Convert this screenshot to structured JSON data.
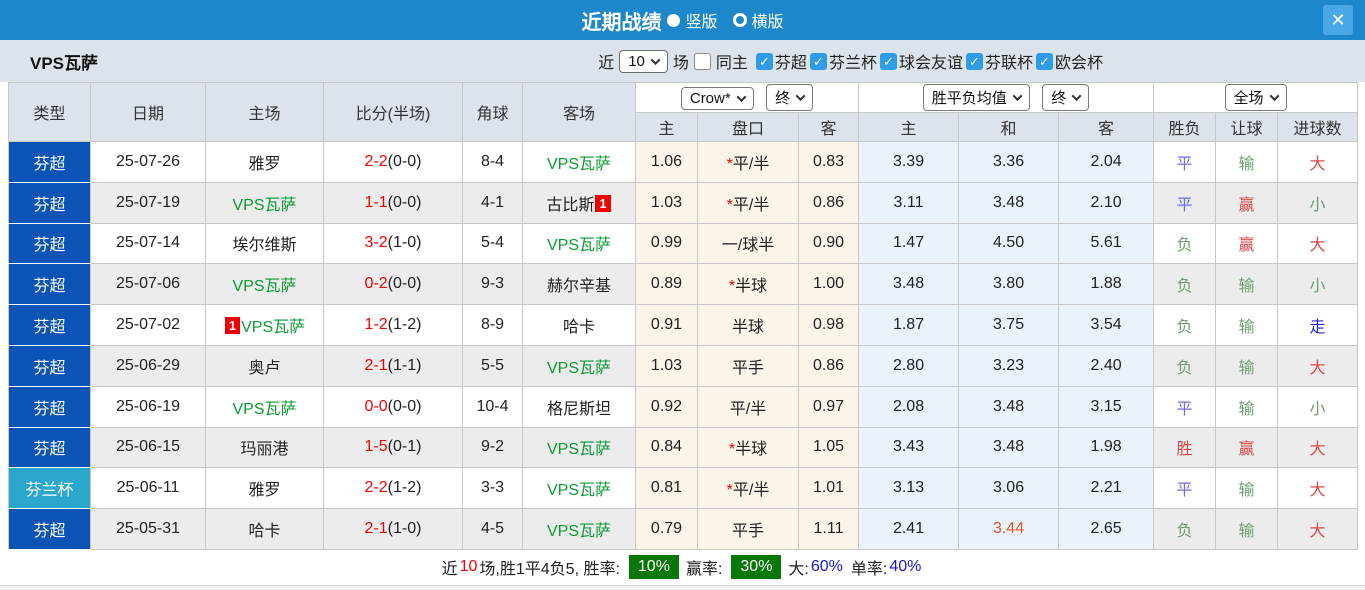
{
  "titlebar": {
    "title": "近期战绩",
    "radio_vertical": "竖版",
    "radio_horizontal": "横版",
    "close": "✕"
  },
  "filterbar": {
    "team": "VPS瓦萨",
    "recent_label": "近",
    "recent_value": "10",
    "matches_label": "场",
    "same_home_label": "同主",
    "leagues": [
      "芬超",
      "芬兰杯",
      "球会友谊",
      "芬联杯",
      "欧会杯"
    ]
  },
  "table": {
    "headers_left": [
      "类型",
      "日期",
      "主场",
      "比分(半场)",
      "角球",
      "客场"
    ],
    "dropdowns": {
      "odds_source": "Crow*",
      "odds_time": "终",
      "wdl_source": "胜平负均值",
      "wdl_time": "终",
      "scope": "全场"
    },
    "subheaders": [
      "主",
      "盘口",
      "客",
      "主",
      "和",
      "客",
      "胜负",
      "让球",
      "进球数"
    ],
    "rows": [
      {
        "type": "芬超",
        "cup": false,
        "date": "25-07-26",
        "home": "雅罗",
        "home_green": false,
        "home_badge": "",
        "home_badge_pos": "",
        "score": "2-2",
        "half": "(0-0)",
        "corner": "8-4",
        "away": "VPS瓦萨",
        "away_green": true,
        "away_badge": "",
        "away_badge_pos": "",
        "crow": [
          "1.06",
          "平/半",
          "0.83"
        ],
        "star": true,
        "europe": [
          "3.39",
          "3.36",
          "2.04"
        ],
        "draw_red": false,
        "results": [
          [
            "平",
            "blue"
          ],
          [
            "输",
            "green"
          ],
          [
            "大",
            "red"
          ]
        ]
      },
      {
        "type": "芬超",
        "cup": false,
        "date": "25-07-19",
        "home": "VPS瓦萨",
        "home_green": true,
        "home_badge": "",
        "home_badge_pos": "",
        "score": "1-1",
        "half": "(0-0)",
        "corner": "4-1",
        "away": "古比斯",
        "away_green": false,
        "away_badge": "1",
        "away_badge_pos": "after",
        "crow": [
          "1.03",
          "平/半",
          "0.86"
        ],
        "star": true,
        "europe": [
          "3.11",
          "3.48",
          "2.10"
        ],
        "draw_red": false,
        "results": [
          [
            "平",
            "blue"
          ],
          [
            "赢",
            "red"
          ],
          [
            "小",
            "green"
          ]
        ]
      },
      {
        "type": "芬超",
        "cup": false,
        "date": "25-07-14",
        "home": "埃尔维斯",
        "home_green": false,
        "home_badge": "",
        "home_badge_pos": "",
        "score": "3-2",
        "half": "(1-0)",
        "corner": "5-4",
        "away": "VPS瓦萨",
        "away_green": true,
        "away_badge": "",
        "away_badge_pos": "",
        "crow": [
          "0.99",
          "一/球半",
          "0.90"
        ],
        "star": false,
        "europe": [
          "1.47",
          "4.50",
          "5.61"
        ],
        "draw_red": false,
        "results": [
          [
            "负",
            "green"
          ],
          [
            "赢",
            "red"
          ],
          [
            "大",
            "red"
          ]
        ]
      },
      {
        "type": "芬超",
        "cup": false,
        "date": "25-07-06",
        "home": "VPS瓦萨",
        "home_green": true,
        "home_badge": "",
        "home_badge_pos": "",
        "score": "0-2",
        "half": "(0-0)",
        "corner": "9-3",
        "away": "赫尔辛基",
        "away_green": false,
        "away_badge": "",
        "away_badge_pos": "",
        "crow": [
          "0.89",
          "半球",
          "1.00"
        ],
        "star": true,
        "europe": [
          "3.48",
          "3.80",
          "1.88"
        ],
        "draw_red": false,
        "results": [
          [
            "负",
            "green"
          ],
          [
            "输",
            "green"
          ],
          [
            "小",
            "green"
          ]
        ]
      },
      {
        "type": "芬超",
        "cup": false,
        "date": "25-07-02",
        "home": "VPS瓦萨",
        "home_green": true,
        "home_badge": "1",
        "home_badge_pos": "before",
        "score": "1-2",
        "half": "(1-2)",
        "corner": "8-9",
        "away": "哈卡",
        "away_green": false,
        "away_badge": "",
        "away_badge_pos": "",
        "crow": [
          "0.91",
          "半球",
          "0.98"
        ],
        "star": false,
        "europe": [
          "1.87",
          "3.75",
          "3.54"
        ],
        "draw_red": false,
        "results": [
          [
            "负",
            "green"
          ],
          [
            "输",
            "green"
          ],
          [
            "走",
            "dblue"
          ]
        ]
      },
      {
        "type": "芬超",
        "cup": false,
        "date": "25-06-29",
        "home": "奥卢",
        "home_green": false,
        "home_badge": "",
        "home_badge_pos": "",
        "score": "2-1",
        "half": "(1-1)",
        "corner": "5-5",
        "away": "VPS瓦萨",
        "away_green": true,
        "away_badge": "",
        "away_badge_pos": "",
        "crow": [
          "1.03",
          "平手",
          "0.86"
        ],
        "star": false,
        "europe": [
          "2.80",
          "3.23",
          "2.40"
        ],
        "draw_red": false,
        "results": [
          [
            "负",
            "green"
          ],
          [
            "输",
            "green"
          ],
          [
            "大",
            "red"
          ]
        ]
      },
      {
        "type": "芬超",
        "cup": false,
        "date": "25-06-19",
        "home": "VPS瓦萨",
        "home_green": true,
        "home_badge": "",
        "home_badge_pos": "",
        "score": "0-0",
        "half": "(0-0)",
        "corner": "10-4",
        "away": "格尼斯坦",
        "away_green": false,
        "away_badge": "",
        "away_badge_pos": "",
        "crow": [
          "0.92",
          "平/半",
          "0.97"
        ],
        "star": false,
        "europe": [
          "2.08",
          "3.48",
          "3.15"
        ],
        "draw_red": false,
        "results": [
          [
            "平",
            "blue"
          ],
          [
            "输",
            "green"
          ],
          [
            "小",
            "green"
          ]
        ]
      },
      {
        "type": "芬超",
        "cup": false,
        "date": "25-06-15",
        "home": "玛丽港",
        "home_green": false,
        "home_badge": "",
        "home_badge_pos": "",
        "score": "1-5",
        "half": "(0-1)",
        "corner": "9-2",
        "away": "VPS瓦萨",
        "away_green": true,
        "away_badge": "",
        "away_badge_pos": "",
        "crow": [
          "0.84",
          "半球",
          "1.05"
        ],
        "star": true,
        "europe": [
          "3.43",
          "3.48",
          "1.98"
        ],
        "draw_red": false,
        "results": [
          [
            "胜",
            "red"
          ],
          [
            "赢",
            "red"
          ],
          [
            "大",
            "red"
          ]
        ]
      },
      {
        "type": "芬兰杯",
        "cup": true,
        "date": "25-06-11",
        "home": "雅罗",
        "home_green": false,
        "home_badge": "",
        "home_badge_pos": "",
        "score": "2-2",
        "half": "(1-2)",
        "corner": "3-3",
        "away": "VPS瓦萨",
        "away_green": true,
        "away_badge": "",
        "away_badge_pos": "",
        "crow": [
          "0.81",
          "平/半",
          "1.01"
        ],
        "star": true,
        "europe": [
          "3.13",
          "3.06",
          "2.21"
        ],
        "draw_red": false,
        "results": [
          [
            "平",
            "blue"
          ],
          [
            "输",
            "green"
          ],
          [
            "大",
            "red"
          ]
        ]
      },
      {
        "type": "芬超",
        "cup": false,
        "date": "25-05-31",
        "home": "哈卡",
        "home_green": false,
        "home_badge": "",
        "home_badge_pos": "",
        "score": "2-1",
        "half": "(1-0)",
        "corner": "4-5",
        "away": "VPS瓦萨",
        "away_green": true,
        "away_badge": "",
        "away_badge_pos": "",
        "crow": [
          "0.79",
          "平手",
          "1.11"
        ],
        "star": false,
        "europe": [
          "2.41",
          "3.44",
          "2.65"
        ],
        "draw_red": true,
        "results": [
          [
            "负",
            "green"
          ],
          [
            "输",
            "green"
          ],
          [
            "大",
            "red"
          ]
        ]
      }
    ]
  },
  "summary": {
    "prefix": "近",
    "count": "10",
    "record": "场,胜1平4负5, 胜率:",
    "win_rate": "10%",
    "handicap_label": "赢率:",
    "handicap_rate": "30%",
    "big_label": "大:",
    "big_rate": "60%",
    "single_label": "单率:",
    "single_rate": "40%"
  },
  "colors": {
    "titlebar_blue": "#1d87cb",
    "close_button_blue": "#49a8e6",
    "league_blue": "#0b53b4",
    "cup_cyan": "#2ba6cd",
    "filterbar_gray": "#dde3ea",
    "header_gray": "#dce3eb",
    "stripe_gray": "#ececec",
    "asian_odds_cream": "#faf4e9",
    "euro_odds_blue": "#e9f3f9",
    "team_green": "#0a9a33",
    "score_red": "#f50000",
    "result_red": "#e04848",
    "result_green": "#6f9e72",
    "result_blue": "#6d6de4",
    "walk_blue": "#2828cf",
    "draw_orange": "#e2552d",
    "summary_badge_green": "#077807",
    "summary_value_blue": "#1515e0",
    "checkbox_blue": "#2e9ce6"
  }
}
